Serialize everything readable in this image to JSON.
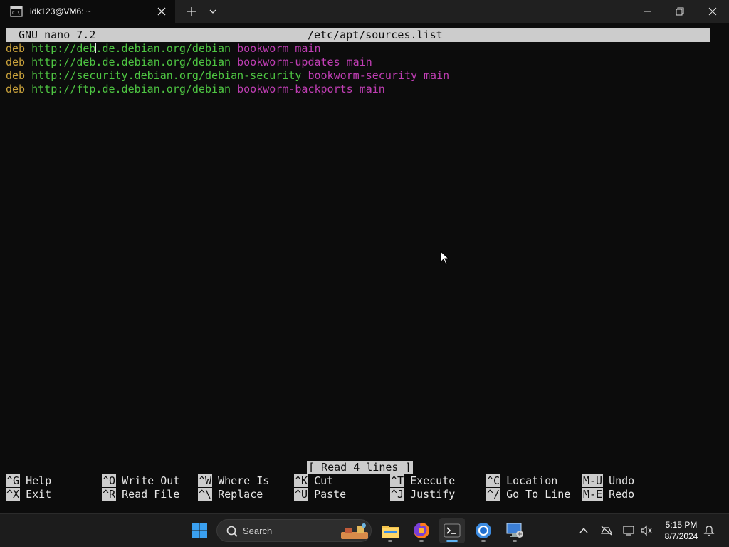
{
  "window": {
    "tab_title": "idk123@VM6: ~"
  },
  "nano": {
    "version": "GNU nano 7.2",
    "filename": "/etc/apt/sources.list",
    "lines": [
      {
        "type": "deb",
        "url_before_cursor": "http://deb",
        "url_after_cursor": ".de.debian.org/debian",
        "suite": "bookworm",
        "component": "main"
      },
      {
        "type": "deb",
        "url": "http://deb.de.debian.org/debian",
        "suite": "bookworm-updates",
        "component": "main"
      },
      {
        "type": "deb",
        "url": "http://security.debian.org/debian-security",
        "suite": "bookworm-security",
        "component": "main"
      },
      {
        "type": "deb",
        "url": "http://ftp.de.debian.org/debian",
        "suite": "bookworm-backports",
        "component": "main"
      }
    ],
    "status_message": "[ Read 4 lines ]",
    "shortcuts": [
      {
        "key": "^G",
        "label": "Help"
      },
      {
        "key": "^O",
        "label": "Write Out"
      },
      {
        "key": "^W",
        "label": "Where Is"
      },
      {
        "key": "^K",
        "label": "Cut"
      },
      {
        "key": "^T",
        "label": "Execute"
      },
      {
        "key": "^C",
        "label": "Location"
      },
      {
        "key": "M-U",
        "label": "Undo"
      },
      {
        "key": "^X",
        "label": "Exit"
      },
      {
        "key": "^R",
        "label": "Read File"
      },
      {
        "key": "^\\",
        "label": "Replace"
      },
      {
        "key": "^U",
        "label": "Paste"
      },
      {
        "key": "^J",
        "label": "Justify"
      },
      {
        "key": "^/",
        "label": "Go To Line"
      },
      {
        "key": "M-E",
        "label": "Redo"
      }
    ]
  },
  "taskbar": {
    "search_placeholder": "Search",
    "apps": [
      "windows-start",
      "file-explorer",
      "firefox",
      "terminal",
      "chrome",
      "remote-desktop"
    ],
    "clock_time": "5:15 PM",
    "clock_date": "8/7/2024"
  },
  "colors": {
    "keyword": "#c8a13b",
    "url": "#4ec542",
    "suite": "#c03eb4",
    "bar_bg": "#cccccc",
    "terminal_bg": "#0c0c0c"
  }
}
